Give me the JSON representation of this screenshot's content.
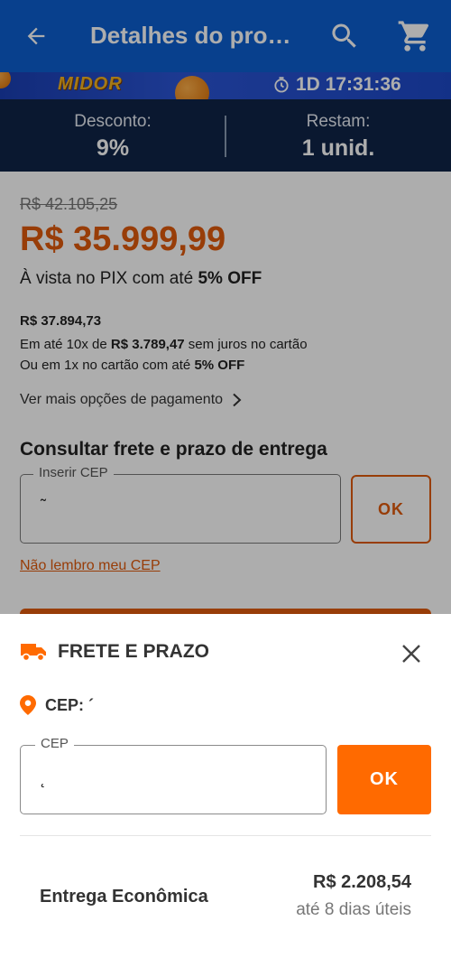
{
  "header": {
    "title": "Detalhes do pro…"
  },
  "promo": {
    "logo_text": "MIDOR",
    "timer": "1D 17:31:36"
  },
  "stats": {
    "discount_label": "Desconto:",
    "discount_value": "9%",
    "remaining_label": "Restam:",
    "remaining_value": "1 unid."
  },
  "pricing": {
    "old_price": "R$ 42.105,25",
    "price": "R$ 35.999,99",
    "pix_text": "À vista no PIX com até ",
    "pix_off": "5% OFF",
    "card_price": "R$ 37.894,73",
    "installments_prefix": "Em até 10x de ",
    "installments_value": "R$ 3.789,47",
    "installments_suffix": " sem juros no cartão",
    "onecard_prefix": "Ou em 1x no cartão com até ",
    "onecard_off": "5% OFF",
    "more_payment": "Ver mais opções de pagamento"
  },
  "shipping": {
    "title": "Consultar frete e prazo de entrega",
    "cep_legend": "Inserir CEP",
    "cep_value": "˜",
    "ok_label": "OK",
    "forgot_cep": "Não lembro meu CEP"
  },
  "sheet": {
    "title": "FRETE E PRAZO",
    "cep_label": "CEP: ´",
    "cep_legend": "CEP",
    "cep_value": "˛",
    "ok_label": "OK",
    "option_name": "Entrega Econômica",
    "option_price": "R$ 2.208,54",
    "option_eta": "até 8 dias úteis"
  },
  "colors": {
    "appbar": "#0d5fd0",
    "stats_bg": "#0f2447",
    "accent_orange": "#e05a0d",
    "ok_orange": "#ff6a00"
  }
}
